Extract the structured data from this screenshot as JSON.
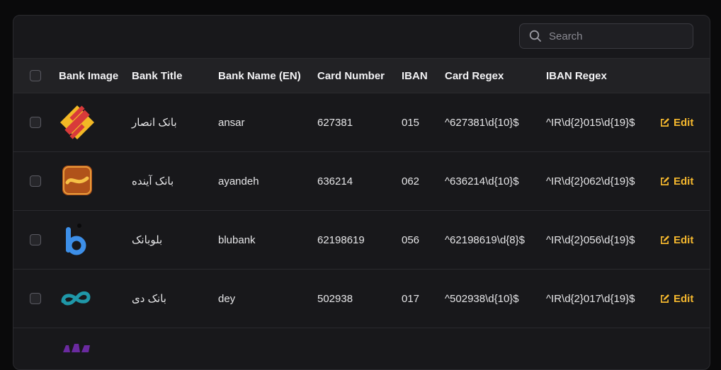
{
  "search": {
    "placeholder": "Search"
  },
  "colors": {
    "accent": "#f5b82e",
    "background": "#18181b",
    "header": "#222225"
  },
  "table": {
    "headers": {
      "bank_image": "Bank Image",
      "bank_title": "Bank Title",
      "bank_name_en": "Bank Name (EN)",
      "card_number": "Card Number",
      "iban": "IBAN",
      "card_regex": "Card Regex",
      "iban_regex": "IBAN Regex"
    },
    "rows": [
      {
        "logo": "ansar-logo",
        "title": "بانک انصار",
        "name": "ansar",
        "card_number": "627381",
        "iban": "015",
        "card_regex": "^627381\\d{10}$",
        "iban_regex": "^IR\\d{2}015\\d{19}$",
        "edit": "Edit"
      },
      {
        "logo": "ayandeh-logo",
        "title": "بانک آینده",
        "name": "ayandeh",
        "card_number": "636214",
        "iban": "062",
        "card_regex": "^636214\\d{10}$",
        "iban_regex": "^IR\\d{2}062\\d{19}$",
        "edit": "Edit"
      },
      {
        "logo": "blubank-logo",
        "title": "بلوبانک",
        "name": "blubank",
        "card_number": "62198619",
        "iban": "056",
        "card_regex": "^62198619\\d{8}$",
        "iban_regex": "^IR\\d{2}056\\d{19}$",
        "edit": "Edit"
      },
      {
        "logo": "dey-logo",
        "title": "بانک دی",
        "name": "dey",
        "card_number": "502938",
        "iban": "017",
        "card_regex": "^502938\\d{10}$",
        "iban_regex": "^IR\\d{2}017\\d{19}$",
        "edit": "Edit"
      }
    ]
  }
}
